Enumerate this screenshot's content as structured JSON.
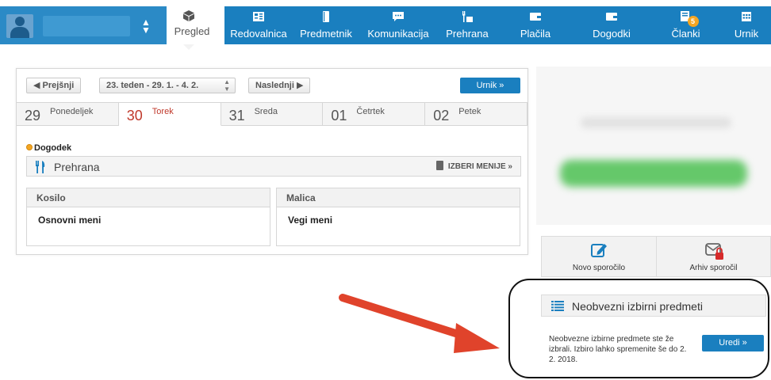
{
  "header": {
    "user_caret_icon": "up-down-caret-icon",
    "active_tab": {
      "label": "Pregled",
      "icon": "cube-icon"
    },
    "nav": [
      {
        "label": "Redovalnica",
        "icon": "gradebook-icon",
        "width": 86
      },
      {
        "label": "Predmetnik",
        "icon": "book-icon",
        "width": 84
      },
      {
        "label": "Komunikacija",
        "icon": "chat-bubble-icon",
        "width": 98
      },
      {
        "label": "Prehrana",
        "icon": "cutlery-icon",
        "width": 76
      },
      {
        "label": "Plačila",
        "icon": "wallet-icon",
        "width": 96
      },
      {
        "label": "Dogodki",
        "icon": "calendar-event-icon",
        "width": 96
      },
      {
        "label": "Članki",
        "icon": "articles-icon",
        "width": 91,
        "badge": "5"
      },
      {
        "label": "Urnik",
        "icon": "timetable-icon",
        "width": 62
      }
    ]
  },
  "week_nav": {
    "prev_label": "◀ Prejšnji",
    "week_label": "23. teden - 29. 1. - 4. 2.",
    "next_label": "Naslednji ▶",
    "urnik_label": "Urnik »"
  },
  "days": [
    {
      "num": "29",
      "name": "Ponedeljek",
      "active": false
    },
    {
      "num": "30",
      "name": "Torek",
      "active": true
    },
    {
      "num": "31",
      "name": "Sreda",
      "active": false
    },
    {
      "num": "01",
      "name": "Četrtek",
      "active": false
    },
    {
      "num": "02",
      "name": "Petek",
      "active": false
    }
  ],
  "event_label": "Dogodek",
  "prehrana": {
    "label": "Prehrana",
    "choose_label": "IZBERI MENIJE »"
  },
  "meals": [
    {
      "title": "Kosilo",
      "menu": "Osnovni meni"
    },
    {
      "title": "Malica",
      "menu": "Vegi meni"
    }
  ],
  "messages": {
    "new_label": "Novo sporočilo",
    "archive_label": "Arhiv sporočil"
  },
  "elective": {
    "title": "Neobvezni izbirni predmeti",
    "text": "Neobvezne izbirne predmete ste že izbrali. Izbiro lahko spremenite še do 2. 2. 2018.",
    "button_label": "Uredi »"
  },
  "colors": {
    "nav_blue": "#1a7fbf",
    "active_red": "#c0392b",
    "badge_orange": "#f4a623",
    "arrow_red": "#e0432b"
  }
}
